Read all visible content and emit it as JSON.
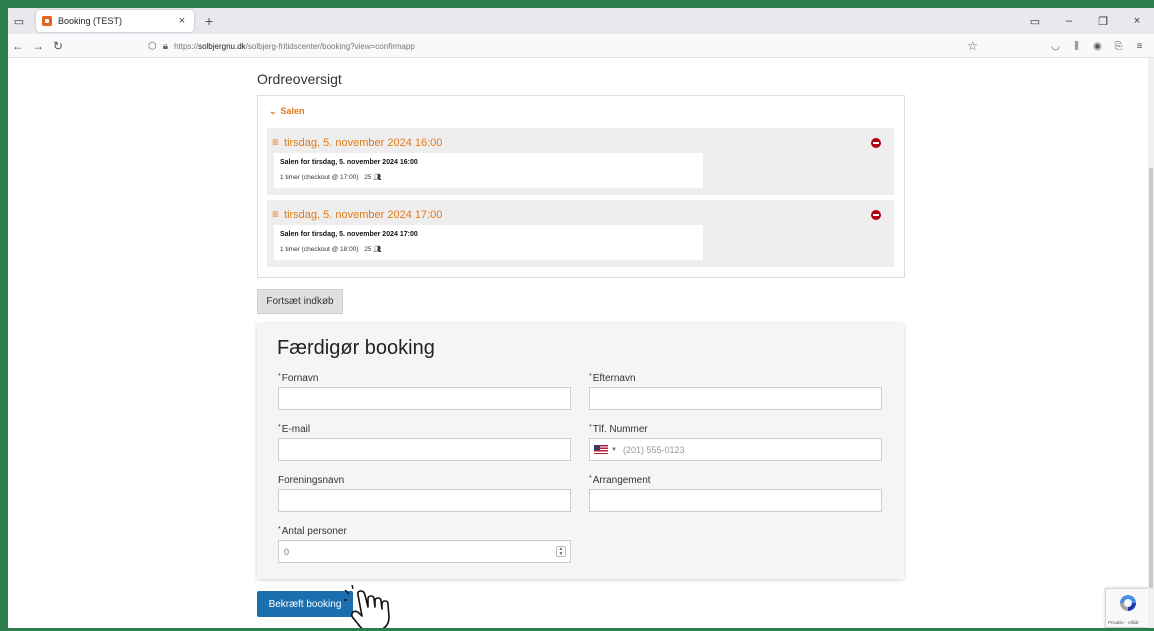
{
  "browser": {
    "tab_title": "Booking (TEST)",
    "tab_close": "×",
    "new_tab": "+",
    "url_prefix": "https://",
    "url_host": "solbjergnu.dk",
    "url_path": "/solbjerg-fritidscenter/booking?view=confirmapp",
    "window_minimize": "–",
    "window_maximize": "❐",
    "window_close": "×"
  },
  "order": {
    "title": "Ordreoversigt",
    "group_name": "Salen",
    "slots": [
      {
        "header": "tirsdag, 5. november 2024 16:00",
        "card_title": "Salen for tirsdag, 5. november 2024 16:00",
        "duration": "1 timer (checkout @ 17:00)",
        "people": "25"
      },
      {
        "header": "tirsdag, 5. november 2024 17:00",
        "card_title": "Salen for tirsdag, 5. november 2024 17:00",
        "duration": "1 timer (checkout @ 18:00)",
        "people": "25"
      }
    ],
    "continue_label": "Fortsæt indkøb"
  },
  "form": {
    "title": "Færdigør booking",
    "required_marker": "*",
    "fields": {
      "first_name": {
        "label": "Fornavn",
        "value": ""
      },
      "last_name": {
        "label": "Efternavn",
        "value": ""
      },
      "email": {
        "label": "E-mail",
        "value": ""
      },
      "phone": {
        "label": "Tlf. Nummer",
        "placeholder": "(201) 555-0123"
      },
      "association": {
        "label": "Foreningsnavn",
        "value": ""
      },
      "event": {
        "label": "Arrangement",
        "value": ""
      },
      "persons": {
        "label": "Antal personer",
        "value": "0"
      }
    },
    "submit_label": "Bekræft booking"
  },
  "recaptcha": {
    "text": "Privatliv - Vilkår"
  },
  "colors": {
    "accent_orange": "#e07b1a",
    "primary_blue": "#1b6fae",
    "remove_red": "#b00010",
    "frame_green": "#2e7d4f"
  }
}
